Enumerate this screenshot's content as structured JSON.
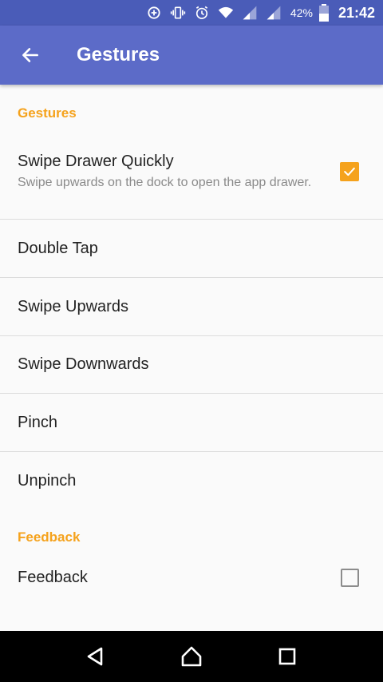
{
  "status_bar": {
    "battery": "42%",
    "time": "21:42",
    "icons": [
      "data-saver-icon",
      "vibrate-icon",
      "alarm-icon",
      "wifi-icon",
      "signal-icon",
      "signal-icon",
      "battery-icon"
    ]
  },
  "app_bar": {
    "title": "Gestures",
    "back_icon": "arrow-back-icon",
    "color": "#5c6bc8"
  },
  "sections": {
    "gestures": {
      "header": "Gestures",
      "swipe_drawer": {
        "title": "Swipe Drawer Quickly",
        "summary": "Swipe upwards on the dock to open the app drawer.",
        "checked": true
      },
      "items": [
        "Double Tap",
        "Swipe Upwards",
        "Swipe Downwards",
        "Pinch",
        "Unpinch"
      ]
    },
    "feedback": {
      "header": "Feedback",
      "item": {
        "title": "Feedback",
        "checked": false
      }
    }
  },
  "nav_bar": {
    "icons": [
      "back-icon",
      "home-icon",
      "recents-icon"
    ]
  },
  "colors": {
    "accent": "#f5a21c",
    "primary": "#5c6bc8",
    "primary_dark": "#4a5cb8"
  }
}
